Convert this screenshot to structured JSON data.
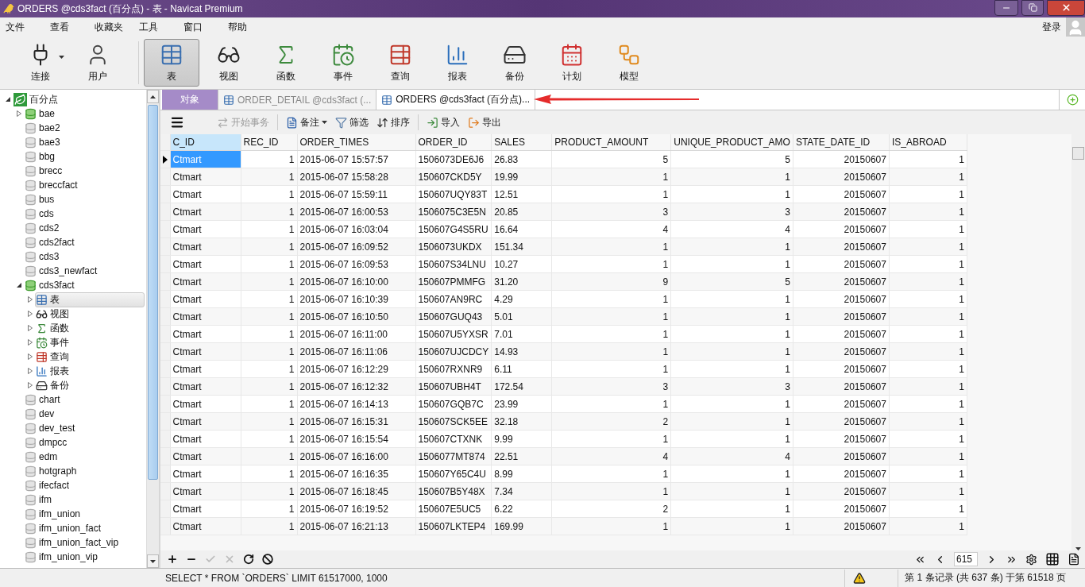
{
  "window": {
    "title": "ORDERS @cds3fact (百分点) - 表 - Navicat Premium"
  },
  "menu": [
    "文件",
    "查看",
    "收藏夹",
    "工具",
    "窗口",
    "帮助"
  ],
  "account": {
    "label": "登录"
  },
  "toolbar": {
    "items": [
      {
        "label": "连接",
        "kind": "connection",
        "selected": false,
        "dropdown": true
      },
      {
        "label": "用户",
        "kind": "user",
        "selected": false
      },
      {
        "label": "表",
        "kind": "table",
        "selected": true
      },
      {
        "label": "视图",
        "kind": "view",
        "selected": false
      },
      {
        "label": "函数",
        "kind": "function",
        "selected": false
      },
      {
        "label": "事件",
        "kind": "event",
        "selected": false
      },
      {
        "label": "查询",
        "kind": "query",
        "selected": false
      },
      {
        "label": "报表",
        "kind": "report",
        "selected": false
      },
      {
        "label": "备份",
        "kind": "backup",
        "selected": false
      },
      {
        "label": "计划",
        "kind": "schedule",
        "selected": false
      },
      {
        "label": "模型",
        "kind": "model",
        "selected": false
      }
    ]
  },
  "sidebar": {
    "tree": [
      {
        "label": "百分点",
        "kind": "connection",
        "expanded": true,
        "selected": false,
        "children": [
          {
            "label": "bae",
            "kind": "database",
            "open": true,
            "expanded": false,
            "selected": false
          },
          {
            "label": "bae2",
            "kind": "database",
            "open": false,
            "selected": false
          },
          {
            "label": "bae3",
            "kind": "database",
            "open": false,
            "selected": false
          },
          {
            "label": "bbg",
            "kind": "database",
            "open": false,
            "selected": false
          },
          {
            "label": "brecc",
            "kind": "database",
            "open": false,
            "selected": false
          },
          {
            "label": "breccfact",
            "kind": "database",
            "open": false,
            "selected": false
          },
          {
            "label": "bus",
            "kind": "database",
            "open": false,
            "selected": false
          },
          {
            "label": "cds",
            "kind": "database",
            "open": false,
            "selected": false
          },
          {
            "label": "cds2",
            "kind": "database",
            "open": false,
            "selected": false
          },
          {
            "label": "cds2fact",
            "kind": "database",
            "open": false,
            "selected": false
          },
          {
            "label": "cds3",
            "kind": "database",
            "open": false,
            "selected": false
          },
          {
            "label": "cds3_newfact",
            "kind": "database",
            "open": false,
            "selected": false
          },
          {
            "label": "cds3fact",
            "kind": "database",
            "open": true,
            "expanded": true,
            "selected": false,
            "children": [
              {
                "label": "表",
                "kind": "tables",
                "expanded": false,
                "selected": true
              },
              {
                "label": "视图",
                "kind": "views",
                "expanded": false,
                "selected": false
              },
              {
                "label": "函数",
                "kind": "functions",
                "expanded": false,
                "selected": false
              },
              {
                "label": "事件",
                "kind": "events",
                "expanded": false,
                "selected": false
              },
              {
                "label": "查询",
                "kind": "queries",
                "expanded": false,
                "selected": false
              },
              {
                "label": "报表",
                "kind": "reports",
                "expanded": false,
                "selected": false
              },
              {
                "label": "备份",
                "kind": "backups",
                "expanded": false,
                "selected": false
              }
            ]
          },
          {
            "label": "chart",
            "kind": "database",
            "open": false,
            "selected": false
          },
          {
            "label": "dev",
            "kind": "database",
            "open": false,
            "selected": false
          },
          {
            "label": "dev_test",
            "kind": "database",
            "open": false,
            "selected": false
          },
          {
            "label": "dmpcc",
            "kind": "database",
            "open": false,
            "selected": false
          },
          {
            "label": "edm",
            "kind": "database",
            "open": false,
            "selected": false
          },
          {
            "label": "hotgraph",
            "kind": "database",
            "open": false,
            "selected": false
          },
          {
            "label": "ifecfact",
            "kind": "database",
            "open": false,
            "selected": false
          },
          {
            "label": "ifm",
            "kind": "database",
            "open": false,
            "selected": false
          },
          {
            "label": "ifm_union",
            "kind": "database",
            "open": false,
            "selected": false
          },
          {
            "label": "ifm_union_fact",
            "kind": "database",
            "open": false,
            "selected": false
          },
          {
            "label": "ifm_union_fact_vip",
            "kind": "database",
            "open": false,
            "selected": false
          },
          {
            "label": "ifm_union_vip",
            "kind": "database",
            "open": false,
            "selected": false
          }
        ]
      }
    ]
  },
  "tabs": [
    {
      "label": "对象",
      "kind": "objects",
      "selected": false
    },
    {
      "label": "ORDER_DETAIL @cds3fact (...",
      "kind": "table",
      "selected": false
    },
    {
      "label": "ORDERS @cds3fact (百分点)...",
      "kind": "table",
      "selected": true
    }
  ],
  "data_toolbar": [
    {
      "label": "开始事务",
      "kind": "transaction",
      "disabled": true
    },
    {
      "label": "备注",
      "kind": "memo",
      "disabled": false
    },
    {
      "label": "筛选",
      "kind": "filter",
      "disabled": false
    },
    {
      "label": "排序",
      "kind": "sort",
      "disabled": false
    },
    {
      "label": "导入",
      "kind": "import",
      "disabled": false
    },
    {
      "label": "导出",
      "kind": "export",
      "disabled": false
    }
  ],
  "table": {
    "columns": [
      "C_ID",
      "REC_ID",
      "ORDER_TIMES",
      "ORDER_ID",
      "SALES",
      "PRODUCT_AMOUNT",
      "UNIQUE_PRODUCT_AMO",
      "STATE_DATE_ID",
      "IS_ABROAD"
    ],
    "rows": [
      {
        "selected": true,
        "cells": [
          "Ctmart",
          "1",
          "2015-06-07 15:57:57",
          "1506073DE6J6",
          "26.83",
          "5",
          "5",
          "20150607",
          "1"
        ]
      },
      {
        "selected": false,
        "cells": [
          "Ctmart",
          "1",
          "2015-06-07 15:58:28",
          "150607CKD5Y",
          "19.99",
          "1",
          "1",
          "20150607",
          "1"
        ]
      },
      {
        "selected": false,
        "cells": [
          "Ctmart",
          "1",
          "2015-06-07 15:59:11",
          "150607UQY83T",
          "12.51",
          "1",
          "1",
          "20150607",
          "1"
        ]
      },
      {
        "selected": false,
        "cells": [
          "Ctmart",
          "1",
          "2015-06-07 16:00:53",
          "1506075C3E5N",
          "20.85",
          "3",
          "3",
          "20150607",
          "1"
        ]
      },
      {
        "selected": false,
        "cells": [
          "Ctmart",
          "1",
          "2015-06-07 16:03:04",
          "150607G4S5RU",
          "16.64",
          "4",
          "4",
          "20150607",
          "1"
        ]
      },
      {
        "selected": false,
        "cells": [
          "Ctmart",
          "1",
          "2015-06-07 16:09:52",
          "1506073UKDX",
          "151.34",
          "1",
          "1",
          "20150607",
          "1"
        ]
      },
      {
        "selected": false,
        "cells": [
          "Ctmart",
          "1",
          "2015-06-07 16:09:53",
          "150607S34LNU",
          "10.27",
          "1",
          "1",
          "20150607",
          "1"
        ]
      },
      {
        "selected": false,
        "cells": [
          "Ctmart",
          "1",
          "2015-06-07 16:10:00",
          "150607PMMFG",
          "31.20",
          "9",
          "5",
          "20150607",
          "1"
        ]
      },
      {
        "selected": false,
        "cells": [
          "Ctmart",
          "1",
          "2015-06-07 16:10:39",
          "150607AN9RC",
          "4.29",
          "1",
          "1",
          "20150607",
          "1"
        ]
      },
      {
        "selected": false,
        "cells": [
          "Ctmart",
          "1",
          "2015-06-07 16:10:50",
          "150607GUQ43",
          "5.01",
          "1",
          "1",
          "20150607",
          "1"
        ]
      },
      {
        "selected": false,
        "cells": [
          "Ctmart",
          "1",
          "2015-06-07 16:11:00",
          "150607U5YXSR",
          "7.01",
          "1",
          "1",
          "20150607",
          "1"
        ]
      },
      {
        "selected": false,
        "cells": [
          "Ctmart",
          "1",
          "2015-06-07 16:11:06",
          "150607UJCDCY",
          "14.93",
          "1",
          "1",
          "20150607",
          "1"
        ]
      },
      {
        "selected": false,
        "cells": [
          "Ctmart",
          "1",
          "2015-06-07 16:12:29",
          "150607RXNR9",
          "6.11",
          "1",
          "1",
          "20150607",
          "1"
        ]
      },
      {
        "selected": false,
        "cells": [
          "Ctmart",
          "1",
          "2015-06-07 16:12:32",
          "150607UBH4T",
          "172.54",
          "3",
          "3",
          "20150607",
          "1"
        ]
      },
      {
        "selected": false,
        "cells": [
          "Ctmart",
          "1",
          "2015-06-07 16:14:13",
          "150607GQB7C",
          "23.99",
          "1",
          "1",
          "20150607",
          "1"
        ]
      },
      {
        "selected": false,
        "cells": [
          "Ctmart",
          "1",
          "2015-06-07 16:15:31",
          "150607SCK5EE",
          "32.18",
          "2",
          "1",
          "20150607",
          "1"
        ]
      },
      {
        "selected": false,
        "cells": [
          "Ctmart",
          "1",
          "2015-06-07 16:15:54",
          "150607CTXNK",
          "9.99",
          "1",
          "1",
          "20150607",
          "1"
        ]
      },
      {
        "selected": false,
        "cells": [
          "Ctmart",
          "1",
          "2015-06-07 16:16:00",
          "1506077MT874",
          "22.51",
          "4",
          "4",
          "20150607",
          "1"
        ]
      },
      {
        "selected": false,
        "cells": [
          "Ctmart",
          "1",
          "2015-06-07 16:16:35",
          "150607Y65C4U",
          "8.99",
          "1",
          "1",
          "20150607",
          "1"
        ]
      },
      {
        "selected": false,
        "cells": [
          "Ctmart",
          "1",
          "2015-06-07 16:18:45",
          "150607B5Y48X",
          "7.34",
          "1",
          "1",
          "20150607",
          "1"
        ]
      },
      {
        "selected": false,
        "cells": [
          "Ctmart",
          "1",
          "2015-06-07 16:19:52",
          "150607E5UC5",
          "6.22",
          "2",
          "1",
          "20150607",
          "1"
        ]
      },
      {
        "selected": false,
        "cells": [
          "Ctmart",
          "1",
          "2015-06-07 16:21:13",
          "150607LKTEP4",
          "169.99",
          "1",
          "1",
          "20150607",
          "1"
        ]
      }
    ]
  },
  "record_bar": {
    "buttons": [
      {
        "kind": "add",
        "disabled": false
      },
      {
        "kind": "delete",
        "disabled": false
      },
      {
        "kind": "apply",
        "disabled": true
      },
      {
        "kind": "discard",
        "disabled": true
      },
      {
        "kind": "refresh",
        "disabled": false
      },
      {
        "kind": "stop",
        "disabled": false
      }
    ],
    "page": "615"
  },
  "status_bar": {
    "sql": "SELECT * FROM `ORDERS` LIMIT 61517000, 1000",
    "warning": true,
    "record_info": "第 1 条记录 (共 637 条) 于第 61518 页"
  }
}
